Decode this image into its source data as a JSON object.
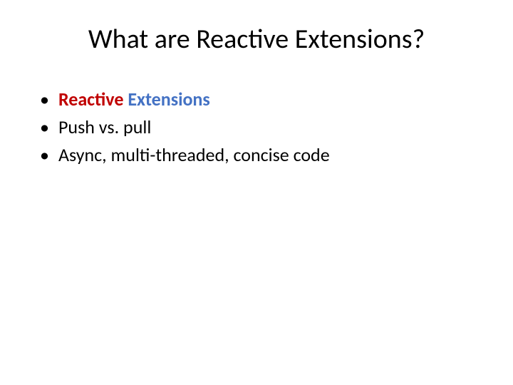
{
  "title": "What are Reactive Extensions?",
  "bullets": [
    {
      "word1": "Reactive",
      "word2": "Extensions"
    },
    {
      "text": "Push vs. pull"
    },
    {
      "text": "Async, multi-threaded, concise code"
    }
  ]
}
